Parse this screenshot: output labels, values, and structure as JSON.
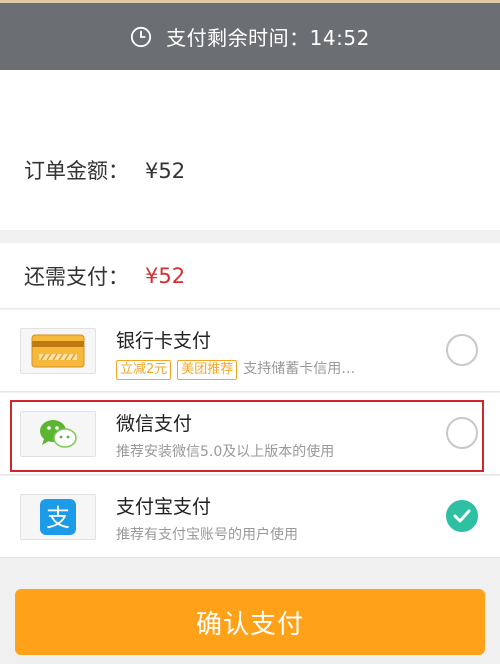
{
  "header": {
    "timer_label": "支付剩余时间：14:52"
  },
  "order": {
    "amount_label": "订单金额：",
    "amount_value": "¥52"
  },
  "need_pay": {
    "label": "还需支付：",
    "value": "¥52"
  },
  "payment_methods": [
    {
      "name": "银行卡支付",
      "icon": "bank-card-icon",
      "tags": [
        "立减2元",
        "美团推荐"
      ],
      "desc": "支持储蓄卡信用…",
      "selected": false
    },
    {
      "name": "微信支付",
      "icon": "wechat-icon",
      "desc": "推荐安装微信5.0及以上版本的使用",
      "selected": false
    },
    {
      "name": "支付宝支付",
      "icon": "alipay-icon",
      "desc": "推荐有支付宝账号的用户使用",
      "selected": true
    }
  ],
  "confirm_button": "确认支付",
  "colors": {
    "header_bg": "#6b6e73",
    "accent_orange": "#ffa21a",
    "price_red": "#d32f2f",
    "check_green": "#2fbfa3",
    "highlight_red": "#d0262b"
  }
}
